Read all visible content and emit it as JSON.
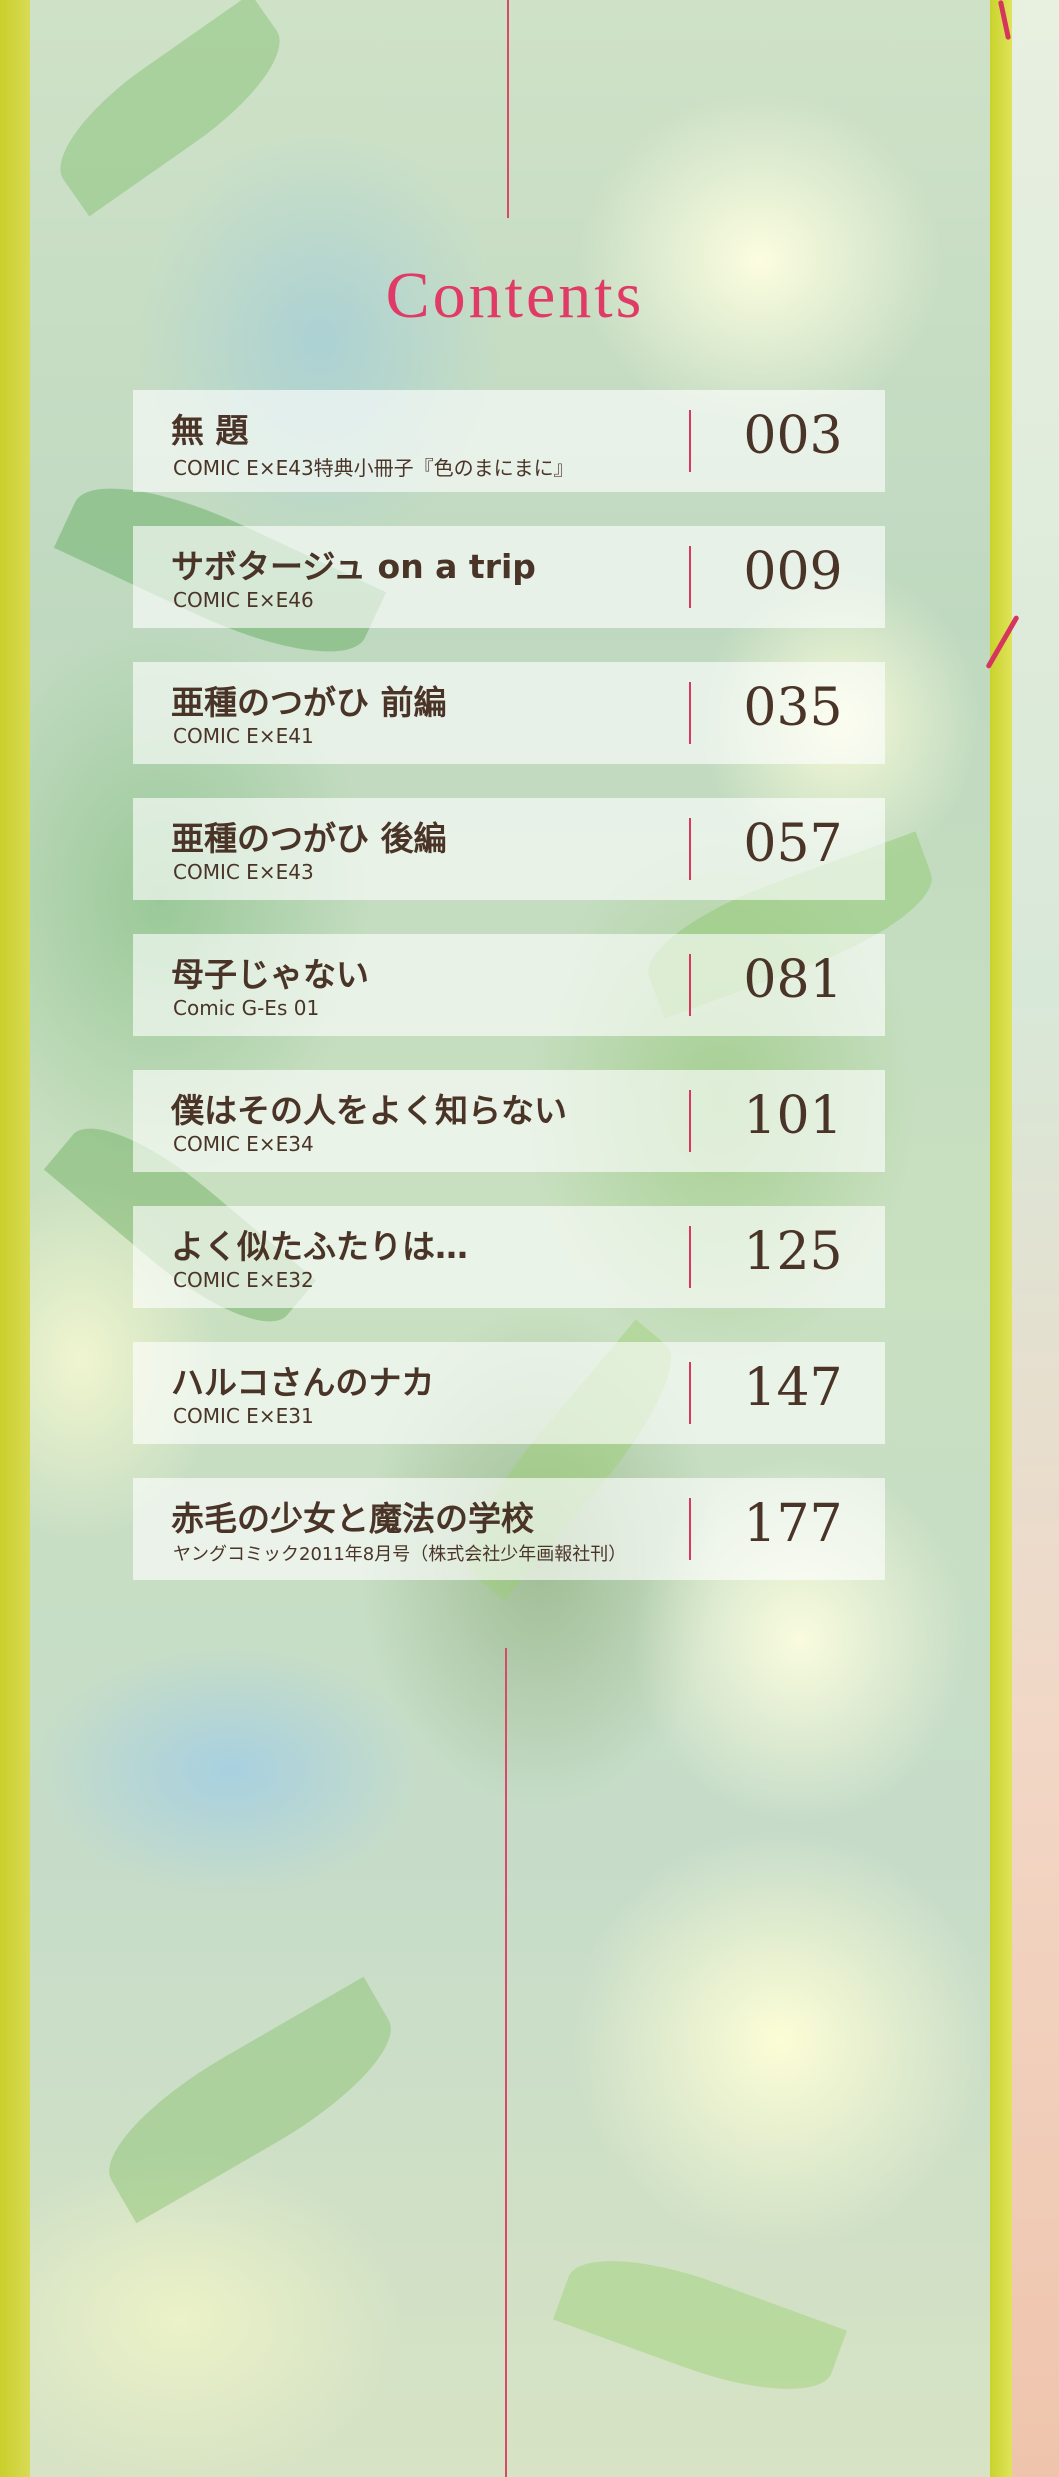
{
  "title": "Contents",
  "entries": [
    {
      "title": "無 題",
      "source": "COMIC E×E43特典小冊子『色のまにまに』",
      "page": "003"
    },
    {
      "title": "サボタージュ on a trip",
      "source": "COMIC E×E46",
      "page": "009"
    },
    {
      "title": "亜種のつがひ 前編",
      "source": "COMIC E×E41",
      "page": "035"
    },
    {
      "title": "亜種のつがひ 後編",
      "source": "COMIC E×E43",
      "page": "057"
    },
    {
      "title": "母子じゃない",
      "source": "Comic G-Es 01",
      "page": "081"
    },
    {
      "title": "僕はその人をよく知らない",
      "source": "COMIC E×E34",
      "page": "101"
    },
    {
      "title": "よく似たふたりは…",
      "source": "COMIC E×E32",
      "page": "125"
    },
    {
      "title": "ハルコさんのナカ",
      "source": "COMIC E×E31",
      "page": "147"
    },
    {
      "title": "赤毛の少女と魔法の学校",
      "source": "ヤングコミック2011年8月号（株式会社少年画報社刊）",
      "page": "177"
    }
  ],
  "colors": {
    "title": "#e03a66",
    "accent_rule": "#d8375f",
    "text": "#4a3428",
    "left_border": "#c9cf2a",
    "right_border": "#c9d32c"
  }
}
